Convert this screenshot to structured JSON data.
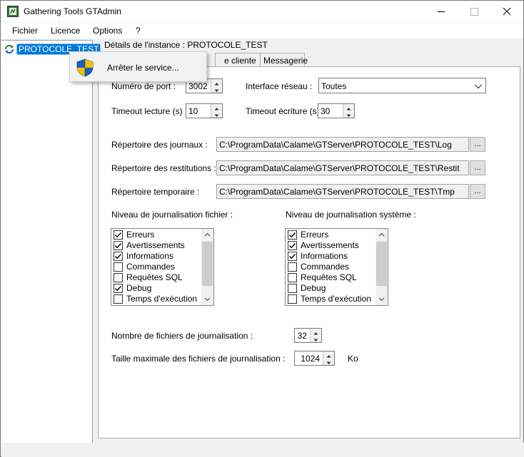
{
  "window": {
    "title": "Gathering Tools GTAdmin",
    "icon": "gtadmin-app-icon",
    "controls": [
      "minimize",
      "maximize",
      "close"
    ]
  },
  "menu": [
    "Fichier",
    "Licence",
    "Options",
    "?"
  ],
  "tree": {
    "node_label": "PROTOCOLE_TEST",
    "node_icon": "service-sync-icon",
    "selected": true
  },
  "details": {
    "title": "Détails de l'instance : PROTOCOLE_TEST",
    "tabs": [
      {
        "label": "e cliente"
      },
      {
        "label": "Messagerie"
      }
    ]
  },
  "context_menu": {
    "item_label": "Arrêter le service...",
    "item_icon": "uac-shield-icon"
  },
  "form": {
    "port_label": "Numéro de port :",
    "port_value": "3002",
    "interface_label": "Interface réseau :",
    "interface_value": "Toutes",
    "timeout_read_label": "Timeout lecture (s) :",
    "timeout_read_value": "10",
    "timeout_write_label": "Timeout écriture (s) :",
    "timeout_write_value": "30",
    "logs_dir_label": "Répertoire des journaux :",
    "logs_dir_value": "C:\\ProgramData\\Calame\\GTServer\\PROTOCOLE_TEST\\Log",
    "restit_dir_label": "Répertoire des restitutions :",
    "restit_dir_value": "C:\\ProgramData\\Calame\\GTServer\\PROTOCOLE_TEST\\Restit",
    "tmp_dir_label": "Répertoire temporaire :",
    "tmp_dir_value": "C:\\ProgramData\\Calame\\GTServer\\PROTOCOLE_TEST\\Tmp",
    "browse_label": "...",
    "file_log_label": "Niveau de journalisation fichier :",
    "system_log_label": "Niveau de journalisation système :",
    "file_log_items": [
      {
        "label": "Erreurs",
        "checked": true
      },
      {
        "label": "Avertissements",
        "checked": true
      },
      {
        "label": "Informations",
        "checked": true
      },
      {
        "label": "Commandes",
        "checked": false
      },
      {
        "label": "Requêtes SQL",
        "checked": false
      },
      {
        "label": "Debug",
        "checked": true
      },
      {
        "label": "Temps d'exécution",
        "checked": false
      }
    ],
    "system_log_items": [
      {
        "label": "Erreurs",
        "checked": true
      },
      {
        "label": "Avertissements",
        "checked": true
      },
      {
        "label": "Informations",
        "checked": true
      },
      {
        "label": "Commandes",
        "checked": false
      },
      {
        "label": "Requêtes SQL",
        "checked": false
      },
      {
        "label": "Debug",
        "checked": false
      },
      {
        "label": "Temps d'exécution",
        "checked": false
      }
    ],
    "log_count_label": "Nombre de fichiers de journalisation :",
    "log_count_value": "32",
    "log_size_label": "Taille maximale des fichiers de journalisation :",
    "log_size_value": "1024",
    "log_size_unit": "Ko"
  },
  "colors": {
    "selection": "#0078d7",
    "window_bg": "#f0f0f0"
  }
}
